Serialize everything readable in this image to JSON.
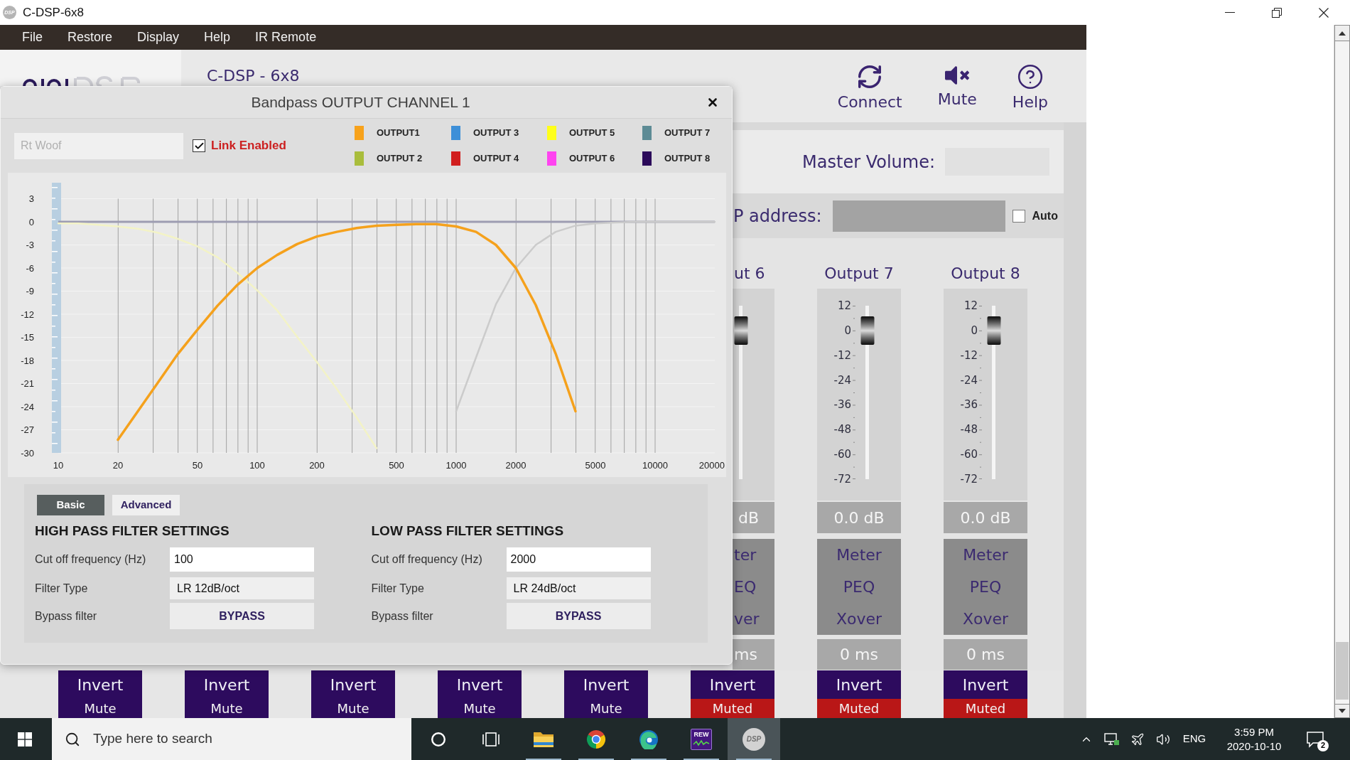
{
  "window": {
    "title": "C-DSP-6x8",
    "icon_label": "DSP"
  },
  "menu": [
    "File",
    "Restore",
    "Display",
    "Help",
    "IR Remote"
  ],
  "header": {
    "subtitle": "C-DSP - 6x8",
    "actions": [
      {
        "kind": "connect",
        "label": "Connect"
      },
      {
        "kind": "mute",
        "label": "Mute"
      },
      {
        "kind": "help",
        "label": "Help"
      }
    ]
  },
  "master_volume": {
    "label": "Master Volume:"
  },
  "ip_address": {
    "label": "P address:",
    "auto": {
      "label": "Auto",
      "checked": false
    }
  },
  "channels": [
    {
      "kind": "covered",
      "invert": "Invert",
      "mute": "Mute",
      "muted": false
    },
    {
      "kind": "covered",
      "invert": "Invert",
      "mute": "Mute",
      "muted": false
    },
    {
      "kind": "covered",
      "invert": "Invert",
      "mute": "Mute",
      "muted": false
    },
    {
      "kind": "covered",
      "invert": "Invert",
      "mute": "Mute",
      "muted": false
    },
    {
      "kind": "covered",
      "invert": "Invert",
      "mute": "Mute",
      "muted": false
    },
    {
      "kind": "partial",
      "title": "ut 6",
      "level": 0.857,
      "gain": "dB",
      "buttons": [
        "ter",
        "EQ",
        "ver"
      ],
      "delay": "ms",
      "invert": "Invert",
      "mute": "Muted",
      "muted": true
    },
    {
      "kind": "full",
      "title": "Output 7",
      "scale": [
        "12",
        "0",
        "-12",
        "-24",
        "-36",
        "-48",
        "-60",
        "-72"
      ],
      "level": 0.857,
      "gain": "0.0 dB",
      "buttons": [
        "Meter",
        "PEQ",
        "Xover"
      ],
      "delay": "0 ms",
      "invert": "Invert",
      "mute": "Muted",
      "muted": true
    },
    {
      "kind": "full",
      "title": "Output 8",
      "scale": [
        "12",
        "0",
        "-12",
        "-24",
        "-36",
        "-48",
        "-60",
        "-72"
      ],
      "level": 0.857,
      "gain": "0.0 dB",
      "buttons": [
        "Meter",
        "PEQ",
        "Xover"
      ],
      "delay": "0 ms",
      "invert": "Invert",
      "mute": "Muted",
      "muted": true
    }
  ],
  "dialog": {
    "title": "Bandpass OUTPUT CHANNEL 1",
    "name_field": {
      "placeholder": "Rt Woof"
    },
    "link": {
      "label": "Link Enabled",
      "checked": true
    },
    "legend": [
      {
        "label": "OUTPUT1",
        "color": "#f7a21b"
      },
      {
        "label": "OUTPUT 3",
        "color": "#3d8fd8"
      },
      {
        "label": "OUTPUT 5",
        "color": "#ffff1a"
      },
      {
        "label": "OUTPUT 7",
        "color": "#5d8b95"
      },
      {
        "label": "OUTPUT 2",
        "color": "#a9bd3c"
      },
      {
        "label": "OUTPUT 4",
        "color": "#d11f1f"
      },
      {
        "label": "OUTPUT 6",
        "color": "#ff44f0"
      },
      {
        "label": "OUTPUT 8",
        "color": "#2b0a5a"
      }
    ],
    "chart_data": {
      "type": "line",
      "categories": [
        "10",
        null,
        null,
        "20",
        null,
        null,
        null,
        "50",
        null,
        null,
        "100",
        null,
        null,
        "200",
        null,
        null,
        null,
        "500",
        null,
        null,
        "1000",
        null,
        null,
        "2000",
        null,
        null,
        null,
        "5000",
        null,
        null,
        "10000",
        null,
        null,
        "20000"
      ],
      "series": [
        {
          "color": "#f3f3c6",
          "values": [
            -0.2,
            -0.2,
            -0.4,
            -0.6,
            -0.9,
            -1.4,
            -2.2,
            -3.2,
            -4.6,
            -6.6,
            -8.9,
            -11.5,
            -14.9,
            -18.2,
            -21.7,
            -25.4,
            -29.4,
            null,
            null,
            null,
            null,
            null,
            null,
            null,
            null,
            null,
            null,
            null,
            null,
            null,
            null,
            null,
            null,
            null
          ]
        },
        {
          "color": "#cbcbcb",
          "values": [
            null,
            null,
            null,
            null,
            null,
            null,
            null,
            null,
            null,
            null,
            null,
            null,
            null,
            null,
            null,
            null,
            null,
            null,
            null,
            null,
            -24.6,
            -17.6,
            -10.7,
            -6,
            -3,
            -1.3,
            -0.5,
            -0.2,
            -0.1,
            0,
            0,
            0,
            0,
            0
          ]
        },
        {
          "color": "#f5a11c",
          "values": [
            null,
            null,
            null,
            -28.3,
            -24.6,
            -20.9,
            -17.2,
            -14,
            -10.9,
            -8.2,
            -6,
            -4.3,
            -2.9,
            -1.9,
            -1.3,
            -0.8,
            -0.5,
            -0.4,
            -0.3,
            -0.3,
            -0.6,
            -1.3,
            -3,
            -6,
            -10.8,
            -17.1,
            -24.6,
            null,
            null,
            null,
            null,
            null,
            null,
            null
          ]
        }
      ],
      "ylim": [
        -30,
        3
      ],
      "yticks": [
        3,
        0,
        -3,
        -6,
        -9,
        -12,
        -15,
        -18,
        -21,
        -24,
        -27,
        -30
      ],
      "grid": true
    },
    "tabs": [
      {
        "label": "Basic",
        "selected": true
      },
      {
        "label": "Advanced",
        "selected": false
      }
    ],
    "filters": [
      {
        "heading": "HIGH PASS FILTER SETTINGS",
        "fields": [
          {
            "kind": "input",
            "label": "Cut off frequency (Hz)",
            "value": "100"
          },
          {
            "kind": "select",
            "label": "Filter Type",
            "value": "LR 12dB/oct"
          },
          {
            "kind": "button",
            "label": "Bypass filter",
            "value": "BYPASS"
          }
        ]
      },
      {
        "heading": "LOW PASS FILTER SETTINGS",
        "fields": [
          {
            "kind": "input",
            "label": "Cut off frequency (Hz)",
            "value": "2000"
          },
          {
            "kind": "select",
            "label": "Filter Type",
            "value": "LR 24dB/oct"
          },
          {
            "kind": "button",
            "label": "Bypass filter",
            "value": "BYPASS"
          }
        ]
      }
    ]
  },
  "taskbar": {
    "search": {
      "placeholder": "Type here to search"
    },
    "apps": [
      {
        "kind": "cortana",
        "running": false,
        "selected": false
      },
      {
        "kind": "task_view",
        "running": false,
        "selected": false
      },
      {
        "kind": "explorer",
        "running": true,
        "selected": false
      },
      {
        "kind": "chrome",
        "running": true,
        "selected": false
      },
      {
        "kind": "edge",
        "running": true,
        "selected": false
      },
      {
        "kind": "rew",
        "label": "REW",
        "running": true,
        "selected": false
      },
      {
        "kind": "dsp",
        "label": "DSP",
        "running": true,
        "selected": true
      }
    ],
    "tray": {
      "language": "ENG",
      "time": "3:59 PM",
      "date": "2020-10-10",
      "notifications": "2"
    }
  }
}
